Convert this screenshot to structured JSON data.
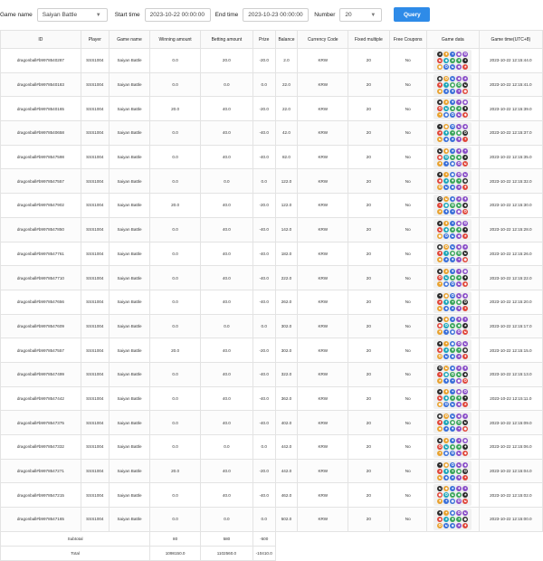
{
  "filters": {
    "game_name_label": "Game name",
    "game_name_value": "Saiyan Battle",
    "start_time_label": "Start time",
    "start_time_value": "2023-10-22 00:00:00",
    "end_time_label": "End time",
    "end_time_value": "2023-10-23 00:00:00",
    "number_label": "Number",
    "number_value": "20",
    "query_label": "Query"
  },
  "table": {
    "columns": [
      "ID",
      "Player",
      "Game name",
      "Winning amount",
      "Betting amount",
      "Prize",
      "Balance",
      "Currency Code",
      "Fixed multiple",
      "Free Coupons",
      "Game data",
      "Game time(UTC+8)"
    ],
    "rows": [
      [
        "dragonball#b9978540287",
        "SSS1004",
        "Saiyan Battle",
        "0.0",
        "20.0",
        "-20.0",
        "2.0",
        "KRW",
        "20",
        "No",
        "",
        "2023-10-22 12:15:44.0"
      ],
      [
        "dragonball#b9978540183",
        "SSS1004",
        "Saiyan Battle",
        "0.0",
        "0.0",
        "0.0",
        "22.0",
        "KRW",
        "20",
        "No",
        "",
        "2023-10-22 12:15:41.0"
      ],
      [
        "dragonball#b9978540165",
        "SSS1004",
        "Saiyan Battle",
        "20.0",
        "40.0",
        "-20.0",
        "22.0",
        "KRW",
        "20",
        "No",
        "",
        "2023-10-22 12:15:39.0"
      ],
      [
        "dragonball#b9978540658",
        "SSS1004",
        "Saiyan Battle",
        "0.0",
        "40.0",
        "-40.0",
        "42.0",
        "KRW",
        "20",
        "No",
        "",
        "2023-10-22 12:15:37.0"
      ],
      [
        "dragonball#b9978547598",
        "SSS1004",
        "Saiyan Battle",
        "0.0",
        "40.0",
        "-40.0",
        "82.0",
        "KRW",
        "20",
        "No",
        "",
        "2023-10-22 12:15:35.0"
      ],
      [
        "dragonball#b9978547557",
        "SSS1004",
        "Saiyan Battle",
        "0.0",
        "0.0",
        "0.0",
        "122.0",
        "KRW",
        "20",
        "No",
        "",
        "2023-10-22 12:15:32.0"
      ],
      [
        "dragonball#b9978547902",
        "SSS1004",
        "Saiyan Battle",
        "20.0",
        "40.0",
        "-20.0",
        "122.0",
        "KRW",
        "20",
        "No",
        "",
        "2023-10-22 12:15:30.0"
      ],
      [
        "dragonball#b9978547850",
        "SSS1004",
        "Saiyan Battle",
        "0.0",
        "40.0",
        "-40.0",
        "142.0",
        "KRW",
        "20",
        "No",
        "",
        "2023-10-22 12:15:28.0"
      ],
      [
        "dragonball#b9978547761",
        "SSS1004",
        "Saiyan Battle",
        "0.0",
        "40.0",
        "-40.0",
        "182.0",
        "KRW",
        "20",
        "No",
        "",
        "2023-10-22 12:15:26.0"
      ],
      [
        "dragonball#b9978547710",
        "SSS1004",
        "Saiyan Battle",
        "0.0",
        "40.0",
        "-40.0",
        "222.0",
        "KRW",
        "20",
        "No",
        "",
        "2023-10-22 12:15:22.0"
      ],
      [
        "dragonball#b9978547656",
        "SSS1004",
        "Saiyan Battle",
        "0.0",
        "40.0",
        "-40.0",
        "262.0",
        "KRW",
        "20",
        "No",
        "",
        "2023-10-22 12:15:20.0"
      ],
      [
        "dragonball#b9978547609",
        "SSS1004",
        "Saiyan Battle",
        "0.0",
        "0.0",
        "0.0",
        "302.0",
        "KRW",
        "20",
        "No",
        "",
        "2023-10-22 12:15:17.0"
      ],
      [
        "dragonball#b9978547557",
        "SSS1004",
        "Saiyan Battle",
        "20.0",
        "40.0",
        "-20.0",
        "302.0",
        "KRW",
        "20",
        "No",
        "",
        "2023-10-22 12:15:15.0"
      ],
      [
        "dragonball#b9978547499",
        "SSS1004",
        "Saiyan Battle",
        "0.0",
        "40.0",
        "-40.0",
        "322.0",
        "KRW",
        "20",
        "No",
        "",
        "2023-10-22 12:15:13.0"
      ],
      [
        "dragonball#b9978547442",
        "SSS1004",
        "Saiyan Battle",
        "0.0",
        "40.0",
        "-40.0",
        "362.0",
        "KRW",
        "20",
        "No",
        "",
        "2023-10-22 12:15:11.0"
      ],
      [
        "dragonball#b9978547375",
        "SSS1004",
        "Saiyan Battle",
        "0.0",
        "40.0",
        "-40.0",
        "402.0",
        "KRW",
        "20",
        "No",
        "",
        "2023-10-22 12:15:09.0"
      ],
      [
        "dragonball#b9978547332",
        "SSS1004",
        "Saiyan Battle",
        "0.0",
        "0.0",
        "0.0",
        "442.0",
        "KRW",
        "20",
        "No",
        "",
        "2023-10-22 12:15:06.0"
      ],
      [
        "dragonball#b9978547271",
        "SSS1004",
        "Saiyan Battle",
        "20.0",
        "40.0",
        "-20.0",
        "442.0",
        "KRW",
        "20",
        "No",
        "",
        "2023-10-22 12:15:04.0"
      ],
      [
        "dragonball#b9978547215",
        "SSS1004",
        "Saiyan Battle",
        "0.0",
        "40.0",
        "-40.0",
        "462.0",
        "KRW",
        "20",
        "No",
        "",
        "2023-10-22 12:15:02.0"
      ],
      [
        "dragonball#b9978547165",
        "SSS1004",
        "Saiyan Battle",
        "0.0",
        "0.0",
        "0.0",
        "502.0",
        "KRW",
        "20",
        "No",
        "",
        "2023-10-22 12:15:00.0"
      ]
    ],
    "subtotal": {
      "label": "Subtotal",
      "winning": "80",
      "betting": "580",
      "prize": "-500"
    },
    "total": {
      "label": "Total",
      "winning": "1098150.0",
      "betting": "1102560.0",
      "prize": "-10410.0"
    }
  },
  "game_data_icons": {
    "symbol_colors": [
      "#2a2a2a",
      "#3a6fd8",
      "#e0463a",
      "#3aa55a",
      "#e8a230",
      "#8a4fc8",
      "#1fa6b8"
    ],
    "symbol_glyphs": [
      "★",
      "●",
      "◆",
      "✦",
      "☯",
      "♦",
      "✪"
    ]
  },
  "icons": {
    "dropdown": "chevron-down-icon"
  }
}
